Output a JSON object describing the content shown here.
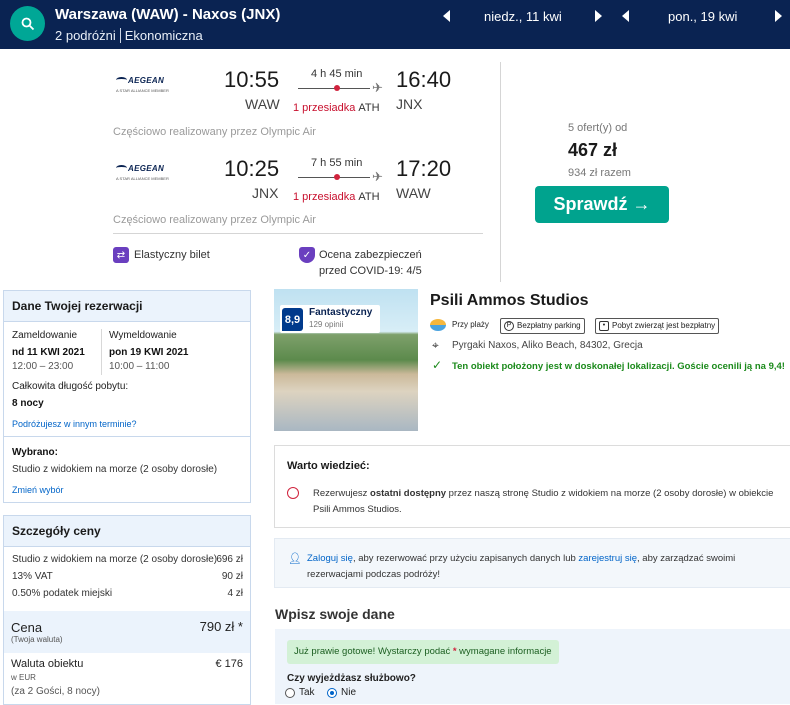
{
  "search": {
    "route": "Warszawa (WAW) - Naxos (JNX)",
    "travellers": "2 podróżni",
    "cabin": "Ekonomiczna",
    "depart_date": "niedz., 11 kwi",
    "return_date": "pon., 19 kwi"
  },
  "flights": [
    {
      "airline": "AEGEAN",
      "alliance": "A STAR ALLIANCE MEMBER",
      "dep_time": "10:55",
      "dep_code": "WAW",
      "arr_time": "16:40",
      "arr_code": "JNX",
      "duration": "4 h 45 min",
      "stops": "1 przesiadka",
      "via": "ATH",
      "operated_by": "Częściowo realizowany przez Olympic Air"
    },
    {
      "airline": "AEGEAN",
      "alliance": "A STAR ALLIANCE MEMBER",
      "dep_time": "10:25",
      "dep_code": "JNX",
      "arr_time": "17:20",
      "arr_code": "WAW",
      "duration": "7 h 55 min",
      "stops": "1 przesiadka",
      "via": "ATH",
      "operated_by": "Częściowo realizowany przez Olympic Air"
    }
  ],
  "features": {
    "flexible": "Elastyczny bilet",
    "covid_line1": "Ocena zabezpieczeń",
    "covid_line2": "przed COVID-19: 4/5"
  },
  "offer": {
    "count": "5 ofert(y) od",
    "price": "467 zł",
    "total": "934 zł razem",
    "button": "Sprawdź →"
  },
  "booking": {
    "title": "Dane Twojej rezerwacji",
    "checkin_label": "Zameldowanie",
    "checkin_date": "nd 11 KWI 2021",
    "checkin_time": "12:00 – 23:00",
    "checkout_label": "Wymeldowanie",
    "checkout_date": "pon 19 KWI 2021",
    "checkout_time": "10:00 – 11:00",
    "length_label": "Całkowita długość pobytu:",
    "length_value": "8 nocy",
    "other_dates_link": "Podróżujesz w innym terminie?",
    "selected_label": "Wybrano:",
    "selected_value": "Studio z widokiem na morze (2 osoby dorosłe)",
    "change_link": "Zmień wybór"
  },
  "price": {
    "title": "Szczegóły ceny",
    "rows": [
      {
        "label": "Studio z widokiem na morze (2 osoby dorosłe)",
        "value": "696 zł"
      },
      {
        "label": "13% VAT",
        "value": "90 zł"
      },
      {
        "label": "0.50% podatek miejski",
        "value": "4 zł"
      }
    ],
    "total_label": "Cena",
    "total_sub": "(Twoja waluta)",
    "total_value": "790 zł *",
    "hotel_currency_label": "Waluta obiektu",
    "hotel_currency_sub": "w EUR",
    "hotel_currency_value": "€ 176",
    "guests_note": "(za 2 Gości, 8 nocy)"
  },
  "hotel": {
    "name": "Psili Ammos Studios",
    "score": "8,9",
    "score_word": "Fantastyczny",
    "reviews": "129 opinii",
    "tag_beach": "Przy plaży",
    "tag_parking": "Bezpłatny parking",
    "tag_pets": "Pobyt zwierząt jest bezpłatny",
    "address": "Pyrgaki Naxos, Aliko Beach, 84302, Grecja",
    "location_note": "Ten obiekt położony jest w doskonałej lokalizacji. Goście ocenili ją na 9,4!"
  },
  "good_to_know": {
    "title": "Warto wiedzieć:",
    "text_pre": "Rezerwujesz ",
    "text_bold": "ostatni dostępny",
    "text_post": " przez naszą stronę Studio z widokiem na morze (2 osoby dorosłe) w obiekcie Psili Ammos Studios."
  },
  "login": {
    "login_link": "Zaloguj się",
    "mid": ", aby rezerwować przy użyciu zapisanych danych lub ",
    "register_link": "zarejestruj się",
    "post": ", aby zarządzać swoimi rezerwacjami podczas podróży!"
  },
  "form": {
    "title": "Wpisz swoje dane",
    "ready_pre": "Już prawie gotowe! Wystarczy podać ",
    "ready_star": "*",
    "ready_post": " wymagane informacje",
    "business_question": "Czy wyjeżdżasz służbowo?",
    "yes": "Tak",
    "no": "Nie"
  },
  "colors": {
    "header_bg": "#0a2352",
    "accent_green": "#00a38e",
    "stop_red": "#c8102e",
    "link_blue": "#0064c8",
    "score_blue": "#003a8c"
  }
}
